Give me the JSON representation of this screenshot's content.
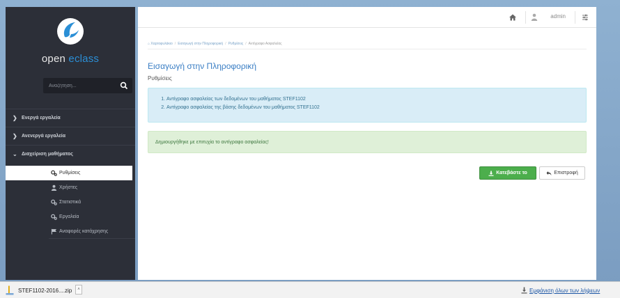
{
  "sidebar": {
    "logo": {
      "text_prefix": "open ",
      "text_accent": "eclass",
      "mark_color": "#2b8fd6"
    },
    "search": {
      "placeholder": "Αναζήτηση..."
    },
    "nav": [
      {
        "label": "Ενεργά εργαλεία",
        "expanded": false
      },
      {
        "label": "Ανενεργά εργαλεία",
        "expanded": false
      },
      {
        "label": "Διαχείριση μαθήματος",
        "expanded": true
      }
    ],
    "sub": [
      {
        "label": "Ρυθμίσεις",
        "icon": "gears-icon",
        "active": true
      },
      {
        "label": "Χρήστες",
        "icon": "user-icon",
        "active": false
      },
      {
        "label": "Στατιστικά",
        "icon": "gears-icon",
        "active": false
      },
      {
        "label": "Εργαλεία",
        "icon": "gears-icon",
        "active": false
      },
      {
        "label": "Αναφορές κατάχρησης",
        "icon": "flag-icon",
        "active": false
      }
    ]
  },
  "topbar": {
    "user": "admin"
  },
  "breadcrumb": {
    "items": [
      "Χαρτοφυλάκιο",
      "Εισαγωγή στην Πληροφορική",
      "Ρυθμίσεις"
    ],
    "last": "Αντίγραφο Ασφαλείας"
  },
  "main": {
    "course_title": "Εισαγωγή στην Πληροφορική",
    "course_subtitle": "Ρυθμίσεις",
    "info_items": [
      "Αντίγραφο ασφαλείας των δεδομένων του μαθήματος STEF1102",
      "Αντίγραφο ασφαλείας της βάσης δεδομένων του μαθήματος STEF1102"
    ],
    "success_message": "Δημιουργήθηκε με επιτυχία το αντίγραφο ασφαλείας!",
    "download_label": "Κατεβάστε το",
    "back_label": "Επιστροφή"
  },
  "download_bar": {
    "file_name": "STEF1102-2016....zip",
    "show_all": "Εμφάνιση όλων των λήψεων"
  },
  "colors": {
    "sidebar_bg": "#2c2f38",
    "accent_blue": "#3a7ec4",
    "success_green": "#4cae4c",
    "info_bg": "#d9edf7",
    "success_bg": "#dff0d8"
  }
}
